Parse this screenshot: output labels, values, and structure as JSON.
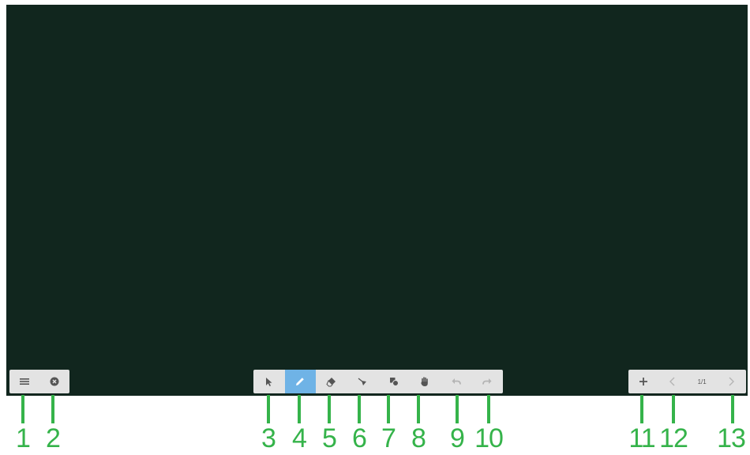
{
  "board": {
    "color": "#11261e"
  },
  "toolbar_left": [
    {
      "icon": "menu-icon"
    },
    {
      "icon": "close-circle-icon"
    }
  ],
  "toolbar_center": [
    {
      "icon": "pointer-arrow-icon",
      "active": false
    },
    {
      "icon": "pen-icon",
      "active": true
    },
    {
      "icon": "eraser-icon",
      "active": false
    },
    {
      "icon": "lasso-select-icon",
      "active": false
    },
    {
      "icon": "shapes-icon",
      "active": false
    },
    {
      "icon": "hand-pan-icon",
      "active": false
    },
    {
      "icon": "undo-icon",
      "enabled": false
    },
    {
      "icon": "redo-icon",
      "enabled": false
    }
  ],
  "toolbar_right": {
    "add_page_icon": "plus-icon",
    "prev_page_icon": "chevron-left-icon",
    "page_indicator": "1/1",
    "next_page_icon": "chevron-right-icon"
  },
  "callouts": [
    "1",
    "2",
    "3",
    "4",
    "5",
    "6",
    "7",
    "8",
    "9",
    "10",
    "11",
    "12",
    "13"
  ],
  "colors": {
    "accent": "#6fb3e6",
    "callout": "#35b34a",
    "toolbar": "#e3e3e3"
  }
}
